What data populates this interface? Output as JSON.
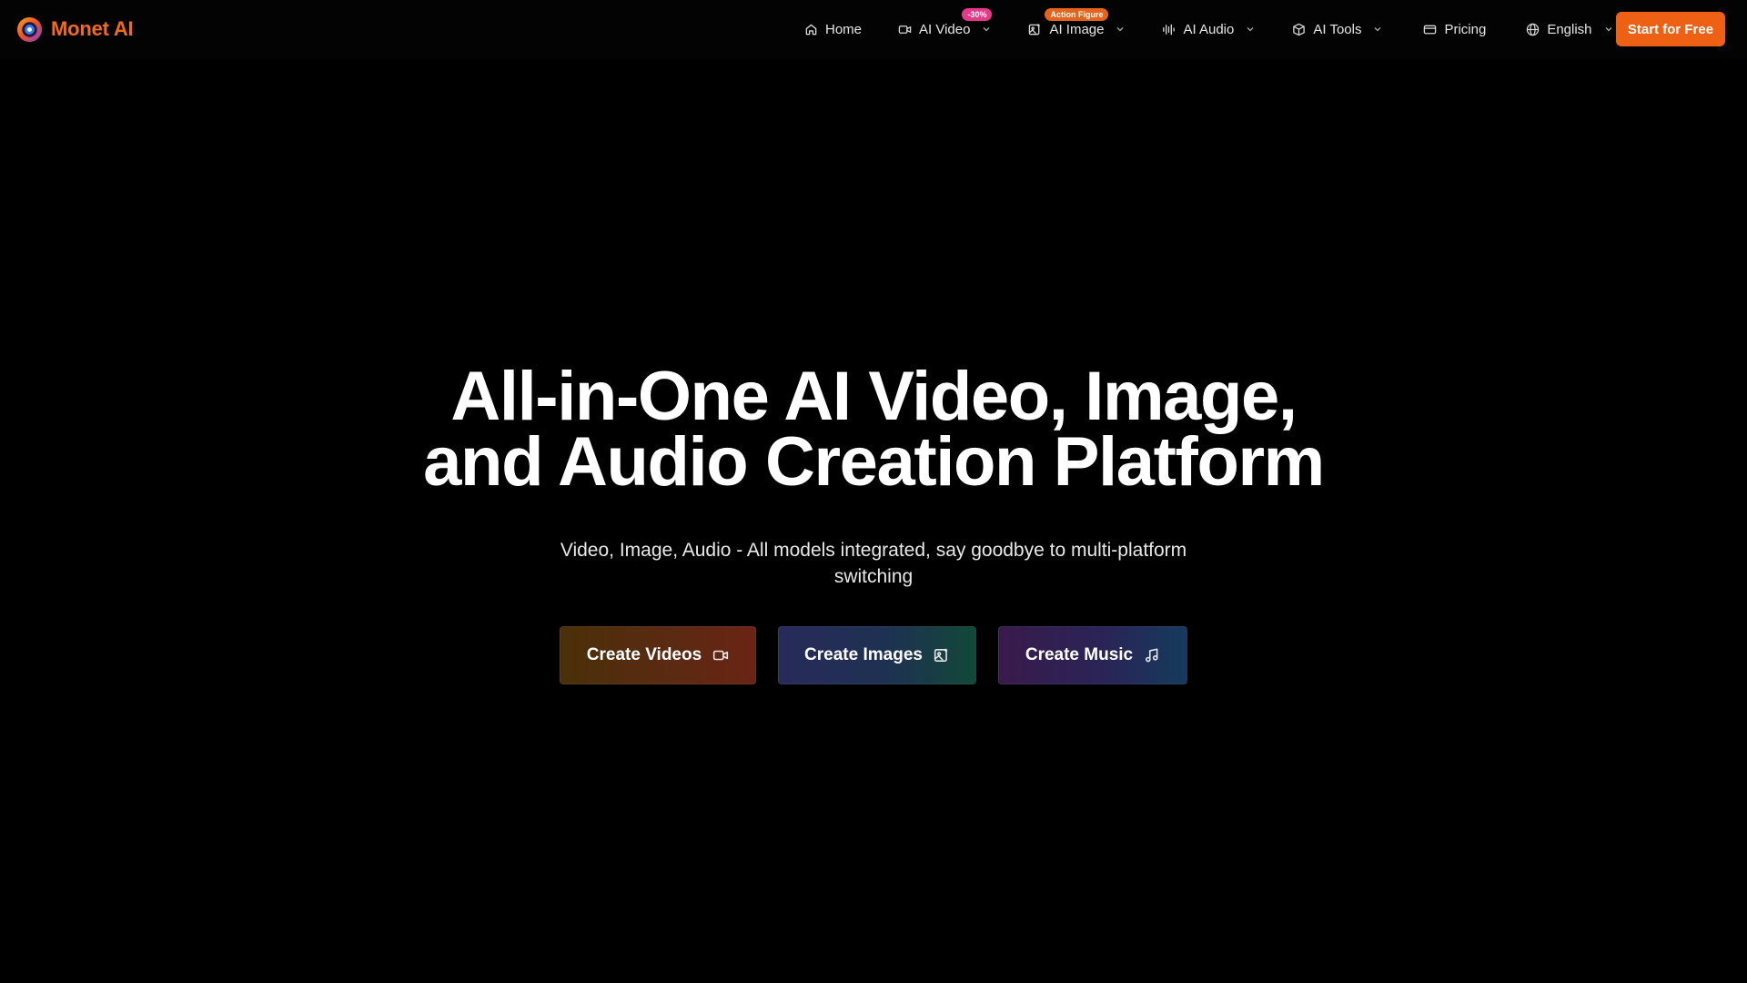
{
  "header": {
    "brand": "Monet AI",
    "nav": [
      {
        "label": "Home",
        "icon": "home-icon",
        "dropdown": false
      },
      {
        "label": "AI Video",
        "icon": "video-camera-icon",
        "dropdown": true,
        "badge": "-30%",
        "badge_color": "#e7398a"
      },
      {
        "label": "AI Image",
        "icon": "image-edit-icon",
        "dropdown": true,
        "badge": "Action Figure",
        "badge_color": "#e5631a"
      },
      {
        "label": "AI Audio",
        "icon": "audio-waveform-icon",
        "dropdown": true
      },
      {
        "label": "AI Tools",
        "icon": "cube-icon",
        "dropdown": true
      },
      {
        "label": "Pricing",
        "icon": "credit-card-icon",
        "dropdown": false
      },
      {
        "label": "English",
        "icon": "globe-icon",
        "dropdown": true
      }
    ],
    "cta_label": "Start for Free"
  },
  "hero": {
    "title_line1": "All-in-One AI Video, Image,",
    "title_line2": "and Audio Creation Platform",
    "subtitle": "Video, Image, Audio - All models integrated, say goodbye to multi-platform switching",
    "buttons": [
      {
        "label": "Create Videos",
        "icon": "video-camera-icon"
      },
      {
        "label": "Create Images",
        "icon": "image-edit-icon"
      },
      {
        "label": "Create Music",
        "icon": "music-note-icon"
      }
    ]
  },
  "colors": {
    "background": "#000000",
    "brand": "#f26a1b",
    "cta": "#ee6014",
    "text": "#ffffff"
  }
}
